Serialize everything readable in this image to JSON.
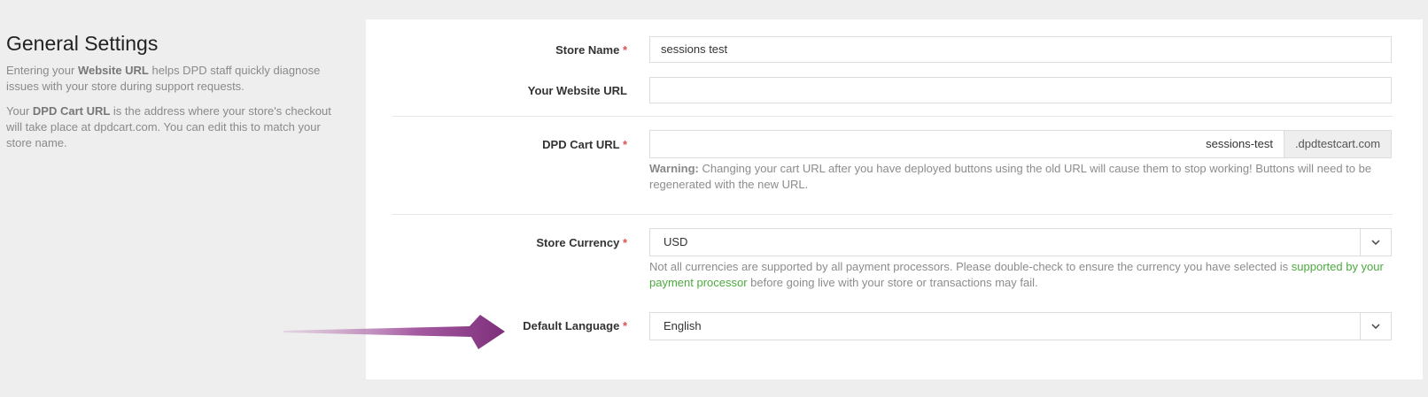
{
  "intro": {
    "title": "General Settings",
    "p1_before": "Entering your ",
    "p1_bold": "Website URL",
    "p1_after": " helps DPD staff quickly diagnose issues with your store during support requests.",
    "p2_before": "Your ",
    "p2_bold": "DPD Cart URL",
    "p2_after": " is the address where your store's checkout will take place at dpdcart.com. You can edit this to match your store name."
  },
  "form": {
    "required_mark": "*",
    "store_name": {
      "label": "Store Name",
      "value": "sessions test"
    },
    "website_url": {
      "label": "Your Website URL",
      "value": ""
    },
    "cart_url": {
      "label": "DPD Cart URL",
      "value": "sessions-test",
      "suffix": ".dpdtestcart.com",
      "warning_bold": "Warning:",
      "warning_text": " Changing your cart URL after you have deployed buttons using the old URL will cause them to stop working! Buttons will need to be regenerated with the new URL."
    },
    "currency": {
      "label": "Store Currency",
      "selected": "USD",
      "help_before": "Not all currencies are supported by all payment processors. Please double-check to ensure the currency you have selected is ",
      "help_link": "supported by your payment processor",
      "help_after": " before going live with your store or transactions may fail."
    },
    "language": {
      "label": "Default Language",
      "selected": "English"
    }
  },
  "icons": {
    "caret": "chevron-down-icon",
    "annotation": "arrow-right-icon"
  },
  "colors": {
    "required": "#d9534f",
    "link": "#4caa3f",
    "arrow": "#8e3f8a"
  }
}
